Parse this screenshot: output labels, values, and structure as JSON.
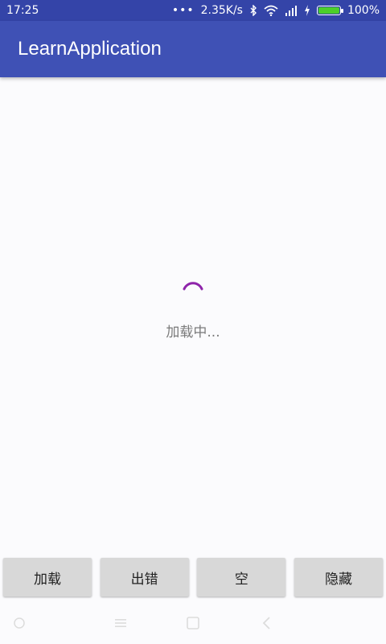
{
  "status_bar": {
    "time": "17:25",
    "network_speed": "2.35K/s",
    "battery_percent": "100%",
    "battery_level": 1.0,
    "icons": [
      "more-dots-icon",
      "bluetooth-icon",
      "wifi-icon",
      "signal-icon",
      "charging-icon",
      "battery-icon"
    ]
  },
  "app_bar": {
    "title": "LearnApplication",
    "color": "#3f51b5"
  },
  "content": {
    "loading_text": "加载中...",
    "spinner_color": "#8e24aa"
  },
  "buttons": {
    "load": "加载",
    "error": "出错",
    "empty": "空",
    "hide": "隐藏"
  },
  "nav_bar": {
    "icons": [
      "menu-icon",
      "hamburger-icon",
      "home-square-icon",
      "back-icon"
    ]
  }
}
